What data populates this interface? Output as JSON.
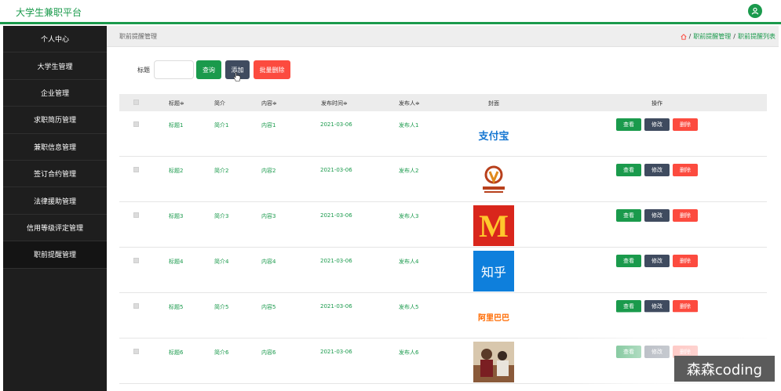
{
  "header": {
    "brand": "大学生兼职平台",
    "user_icon": "user-icon"
  },
  "sidebar": {
    "items": [
      {
        "label": "个人中心"
      },
      {
        "label": "大学生管理"
      },
      {
        "label": "企业管理"
      },
      {
        "label": "求职简历管理"
      },
      {
        "label": "兼职信息管理"
      },
      {
        "label": "签订合约管理"
      },
      {
        "label": "法律援助管理"
      },
      {
        "label": "信用等级评定管理"
      },
      {
        "label": "职前提醒管理"
      }
    ]
  },
  "breadcrumb": {
    "page_title": "职前提醒管理",
    "path_1": "职前提醒管理",
    "separator": "/",
    "path_2": "职前提醒列表"
  },
  "search": {
    "label": "标题",
    "placeholder": "",
    "query_label": "查询",
    "add_label": "添加",
    "batch_delete_label": "批量删除"
  },
  "table": {
    "headers": {
      "title": "标题≑",
      "intro": "简介",
      "content": "内容≑",
      "publish_time": "发布时间≑",
      "publisher": "发布人≑",
      "cover": "封面",
      "actions": "操作"
    },
    "rows": [
      {
        "title": "标题1",
        "intro": "简介1",
        "content": "内容1",
        "publish_time": "2021-03-06",
        "publisher": "发布人1",
        "cover_text": "支付宝"
      },
      {
        "title": "标题2",
        "intro": "简介2",
        "content": "内容2",
        "publish_time": "2021-03-06",
        "publisher": "发布人2",
        "cover_text": ""
      },
      {
        "title": "标题3",
        "intro": "简介3",
        "content": "内容3",
        "publish_time": "2021-03-06",
        "publisher": "发布人3",
        "cover_text": "M"
      },
      {
        "title": "标题4",
        "intro": "简介4",
        "content": "内容4",
        "publish_time": "2021-03-06",
        "publisher": "发布人4",
        "cover_text": "知乎"
      },
      {
        "title": "标题5",
        "intro": "简介5",
        "content": "内容5",
        "publish_time": "2021-03-06",
        "publisher": "发布人5",
        "cover_text": "阿里巴巴"
      },
      {
        "title": "标题6",
        "intro": "简介6",
        "content": "内容6",
        "publish_time": "2021-03-06",
        "publisher": "发布人6",
        "cover_text": ""
      }
    ],
    "view_label": "查看",
    "edit_label": "修改",
    "delete_label": "删除"
  },
  "watermark": "森森coding",
  "colors": {
    "primary": "#1a9a4c",
    "dark_button": "#3f4b5f",
    "danger": "#fc4b3f",
    "sidebar": "#1e1e1e"
  }
}
